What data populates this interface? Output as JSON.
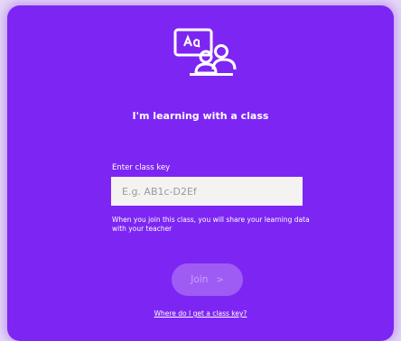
{
  "heading": "I'm learning with a class",
  "class_key": {
    "label": "Enter class key",
    "placeholder": "E.g. AB1c-D2Ef",
    "value": ""
  },
  "notice": "When you join this class, you will share your learning data with your teacher",
  "join_button": {
    "label": "Join",
    "chevron": ">"
  },
  "help_link": "Where do I get a class key?",
  "icons": {
    "logo": "classroom-icon"
  },
  "colors": {
    "card_background": "#7d26f3",
    "page_background": "#e6d6f7",
    "input_background": "#f5f2f2",
    "join_button_background": "#9f5cf5",
    "join_button_text": "#c7a3f9"
  }
}
